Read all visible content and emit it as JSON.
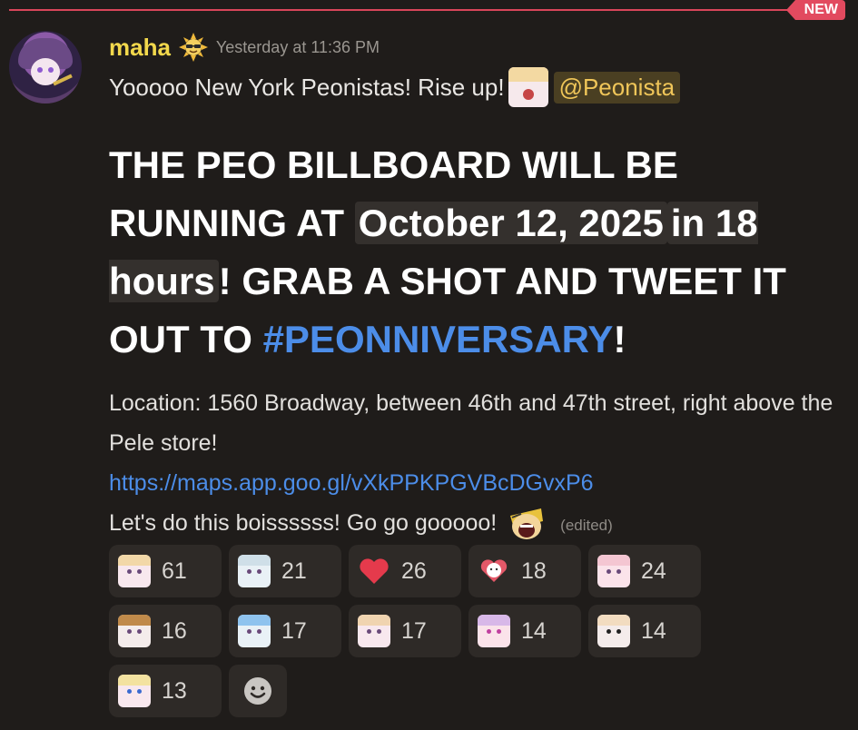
{
  "divider": {
    "badge": "NEW"
  },
  "message": {
    "username": "maha",
    "role_icon": "sun-with-sunglasses-icon",
    "timestamp": "Yesterday at 11:36 PM",
    "line1_text": "Yooooo New York Peonistas! Rise up!",
    "line1_emoji": "anime-girl-shocked-emoji",
    "mention": "@Peonista",
    "headline_part1": "THE PEO BILLBOARD WILL BE RUNNING AT ",
    "headline_timestamp": "October 12, 2025",
    "headline_relative": "in 18 hours",
    "headline_part2": "! GRAB A SHOT AND TWEET IT OUT TO ",
    "hashtag": "#PEONNIVERSARY",
    "headline_end": "!",
    "location_line": "Location: 1560 Broadway, between 46th and 47th street, right above the Pele store!",
    "link": "https://maps.app.goo.gl/vXkPPKPGVBcDGvxP6",
    "closing_text": "Let's do this boissssss! Go go gooooo!",
    "closing_emoji": "screaming-face-emoji",
    "edited": "(edited)"
  },
  "reactions": [
    {
      "emoji": "anime-girl-pink-emoji",
      "count": "61"
    },
    {
      "emoji": "chibi-running-emoji",
      "count": "21"
    },
    {
      "emoji": "red-heart-emoji",
      "count": "26"
    },
    {
      "emoji": "heart-hug-emoji",
      "count": "18"
    },
    {
      "emoji": "anime-girl-blush-emoji",
      "count": "24"
    },
    {
      "emoji": "anime-cookie-emoji",
      "count": "16"
    },
    {
      "emoji": "omg-emoji",
      "count": "17"
    },
    {
      "emoji": "anime-girl-blonde-emoji",
      "count": "17"
    },
    {
      "emoji": "anime-girl-sunglasses-emoji",
      "count": "14"
    },
    {
      "emoji": "anime-girl-glasses-emoji",
      "count": "14"
    },
    {
      "emoji": "anime-girl-flag-emoji",
      "count": "13"
    }
  ],
  "colors": {
    "background": "#1f1c1a",
    "username": "#f2d84c",
    "link": "#4c8de8",
    "new_badge": "#e24a5f",
    "mention_bg": "#4a3f22",
    "heart": "#e53a4c"
  }
}
